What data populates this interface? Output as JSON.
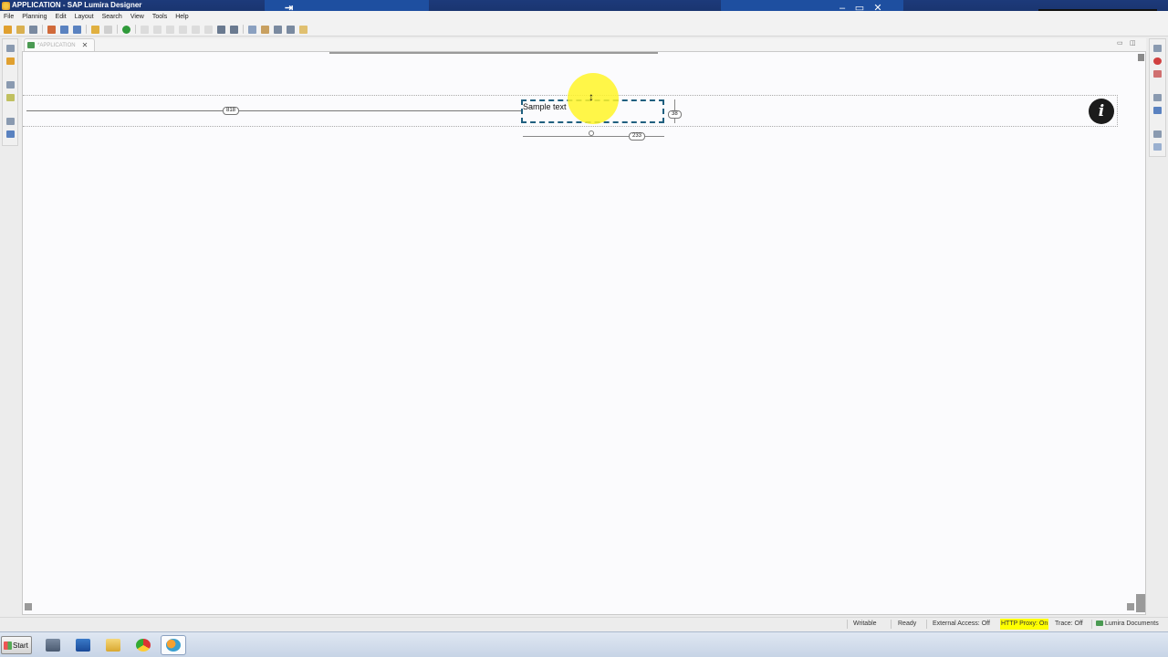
{
  "window": {
    "title": "APPLICATION - SAP Lumira Designer",
    "controls": {
      "minimize": "–",
      "restore": "▭",
      "close": "✕"
    }
  },
  "menubar": {
    "items": [
      "File",
      "Planning",
      "Edit",
      "Layout",
      "Search",
      "View",
      "Tools",
      "Help"
    ]
  },
  "editor": {
    "tab_label": "*APPLICATION",
    "tab_close": "✕"
  },
  "canvas": {
    "text_component": "Sample text",
    "dimensions": {
      "left_margin": "818",
      "height": "38",
      "width": "233"
    }
  },
  "statusbar": {
    "writable": "Writable",
    "ready": "Ready",
    "external_access": "External Access: Off",
    "http_proxy": "HTTP Proxy: On",
    "trace": "Trace: Off",
    "documents": "Lumira Documents"
  },
  "taskbar": {
    "start_label": "Start",
    "apps": [
      "server-manager-icon",
      "powershell-icon",
      "explorer-folder-icon",
      "chrome-icon",
      "lumira-designer-icon"
    ]
  },
  "colors": {
    "titlebar": "#1d3a7a",
    "selection": "#1f5f7f",
    "highlight_circle": "#fff528",
    "proxy_highlight": "#ffff00"
  }
}
